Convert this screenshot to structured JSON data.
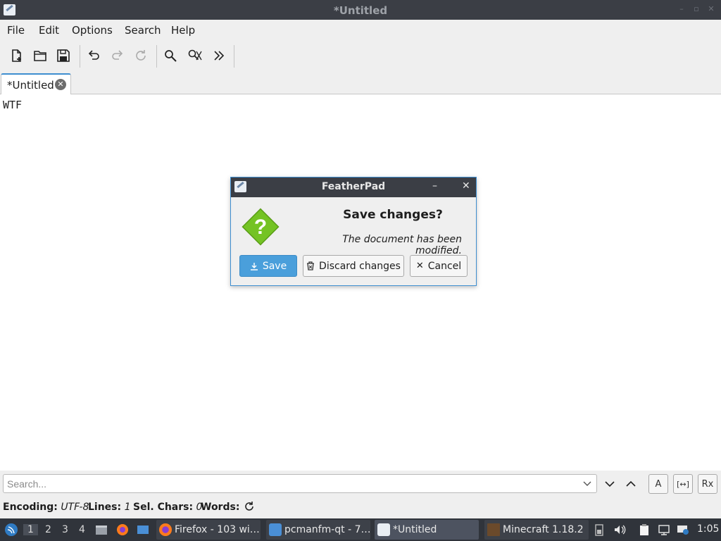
{
  "window": {
    "title": "*Untitled",
    "controls": [
      "minimize-icon",
      "maximize-icon",
      "close-icon"
    ]
  },
  "menubar": {
    "items": [
      {
        "label": "File"
      },
      {
        "label": "Edit"
      },
      {
        "label": "Options"
      },
      {
        "label": "Search"
      },
      {
        "label": "Help"
      }
    ]
  },
  "toolbar": {
    "buttons": [
      "new-document-icon",
      "open-folder-icon",
      "save-icon",
      "undo-icon",
      "redo-icon",
      "reload-icon",
      "find-icon",
      "find-replace-icon",
      "more-icon"
    ]
  },
  "tabs": [
    {
      "label": "*Untitled"
    }
  ],
  "editor": {
    "content": "WTF"
  },
  "search": {
    "placeholder": "Search...",
    "value": "",
    "toggle_labels": {
      "match_case": "A",
      "whole_word": "[↔]",
      "regex": "Rx"
    }
  },
  "statusbar": {
    "encoding_label": "Encoding:",
    "encoding_value": "UTF-8",
    "lines_label": "Lines:",
    "lines_value": "1",
    "sel_label": "Sel. Chars:",
    "sel_value": "0",
    "words_label": "Words:"
  },
  "dialog": {
    "title": "FeatherPad",
    "heading": "Save changes?",
    "message": "The document has been modified.",
    "buttons": {
      "save": "Save",
      "discard": "Discard changes",
      "cancel": "Cancel"
    }
  },
  "taskbar": {
    "workspaces": [
      "1",
      "2",
      "3",
      "4"
    ],
    "tasks": [
      {
        "label": "Firefox - 103 wi…"
      },
      {
        "label": "pcmanfm-qt - 7…"
      },
      {
        "label": "*Untitled"
      },
      {
        "label": "Minecraft 1.18.2"
      }
    ],
    "clock": "1:05"
  },
  "colors": {
    "accent": "#3e8ed0",
    "titlebar": "#3b3e45",
    "taskbar": "#30343b",
    "save_button": "#4a9fdb",
    "question_icon": "#74c324"
  }
}
